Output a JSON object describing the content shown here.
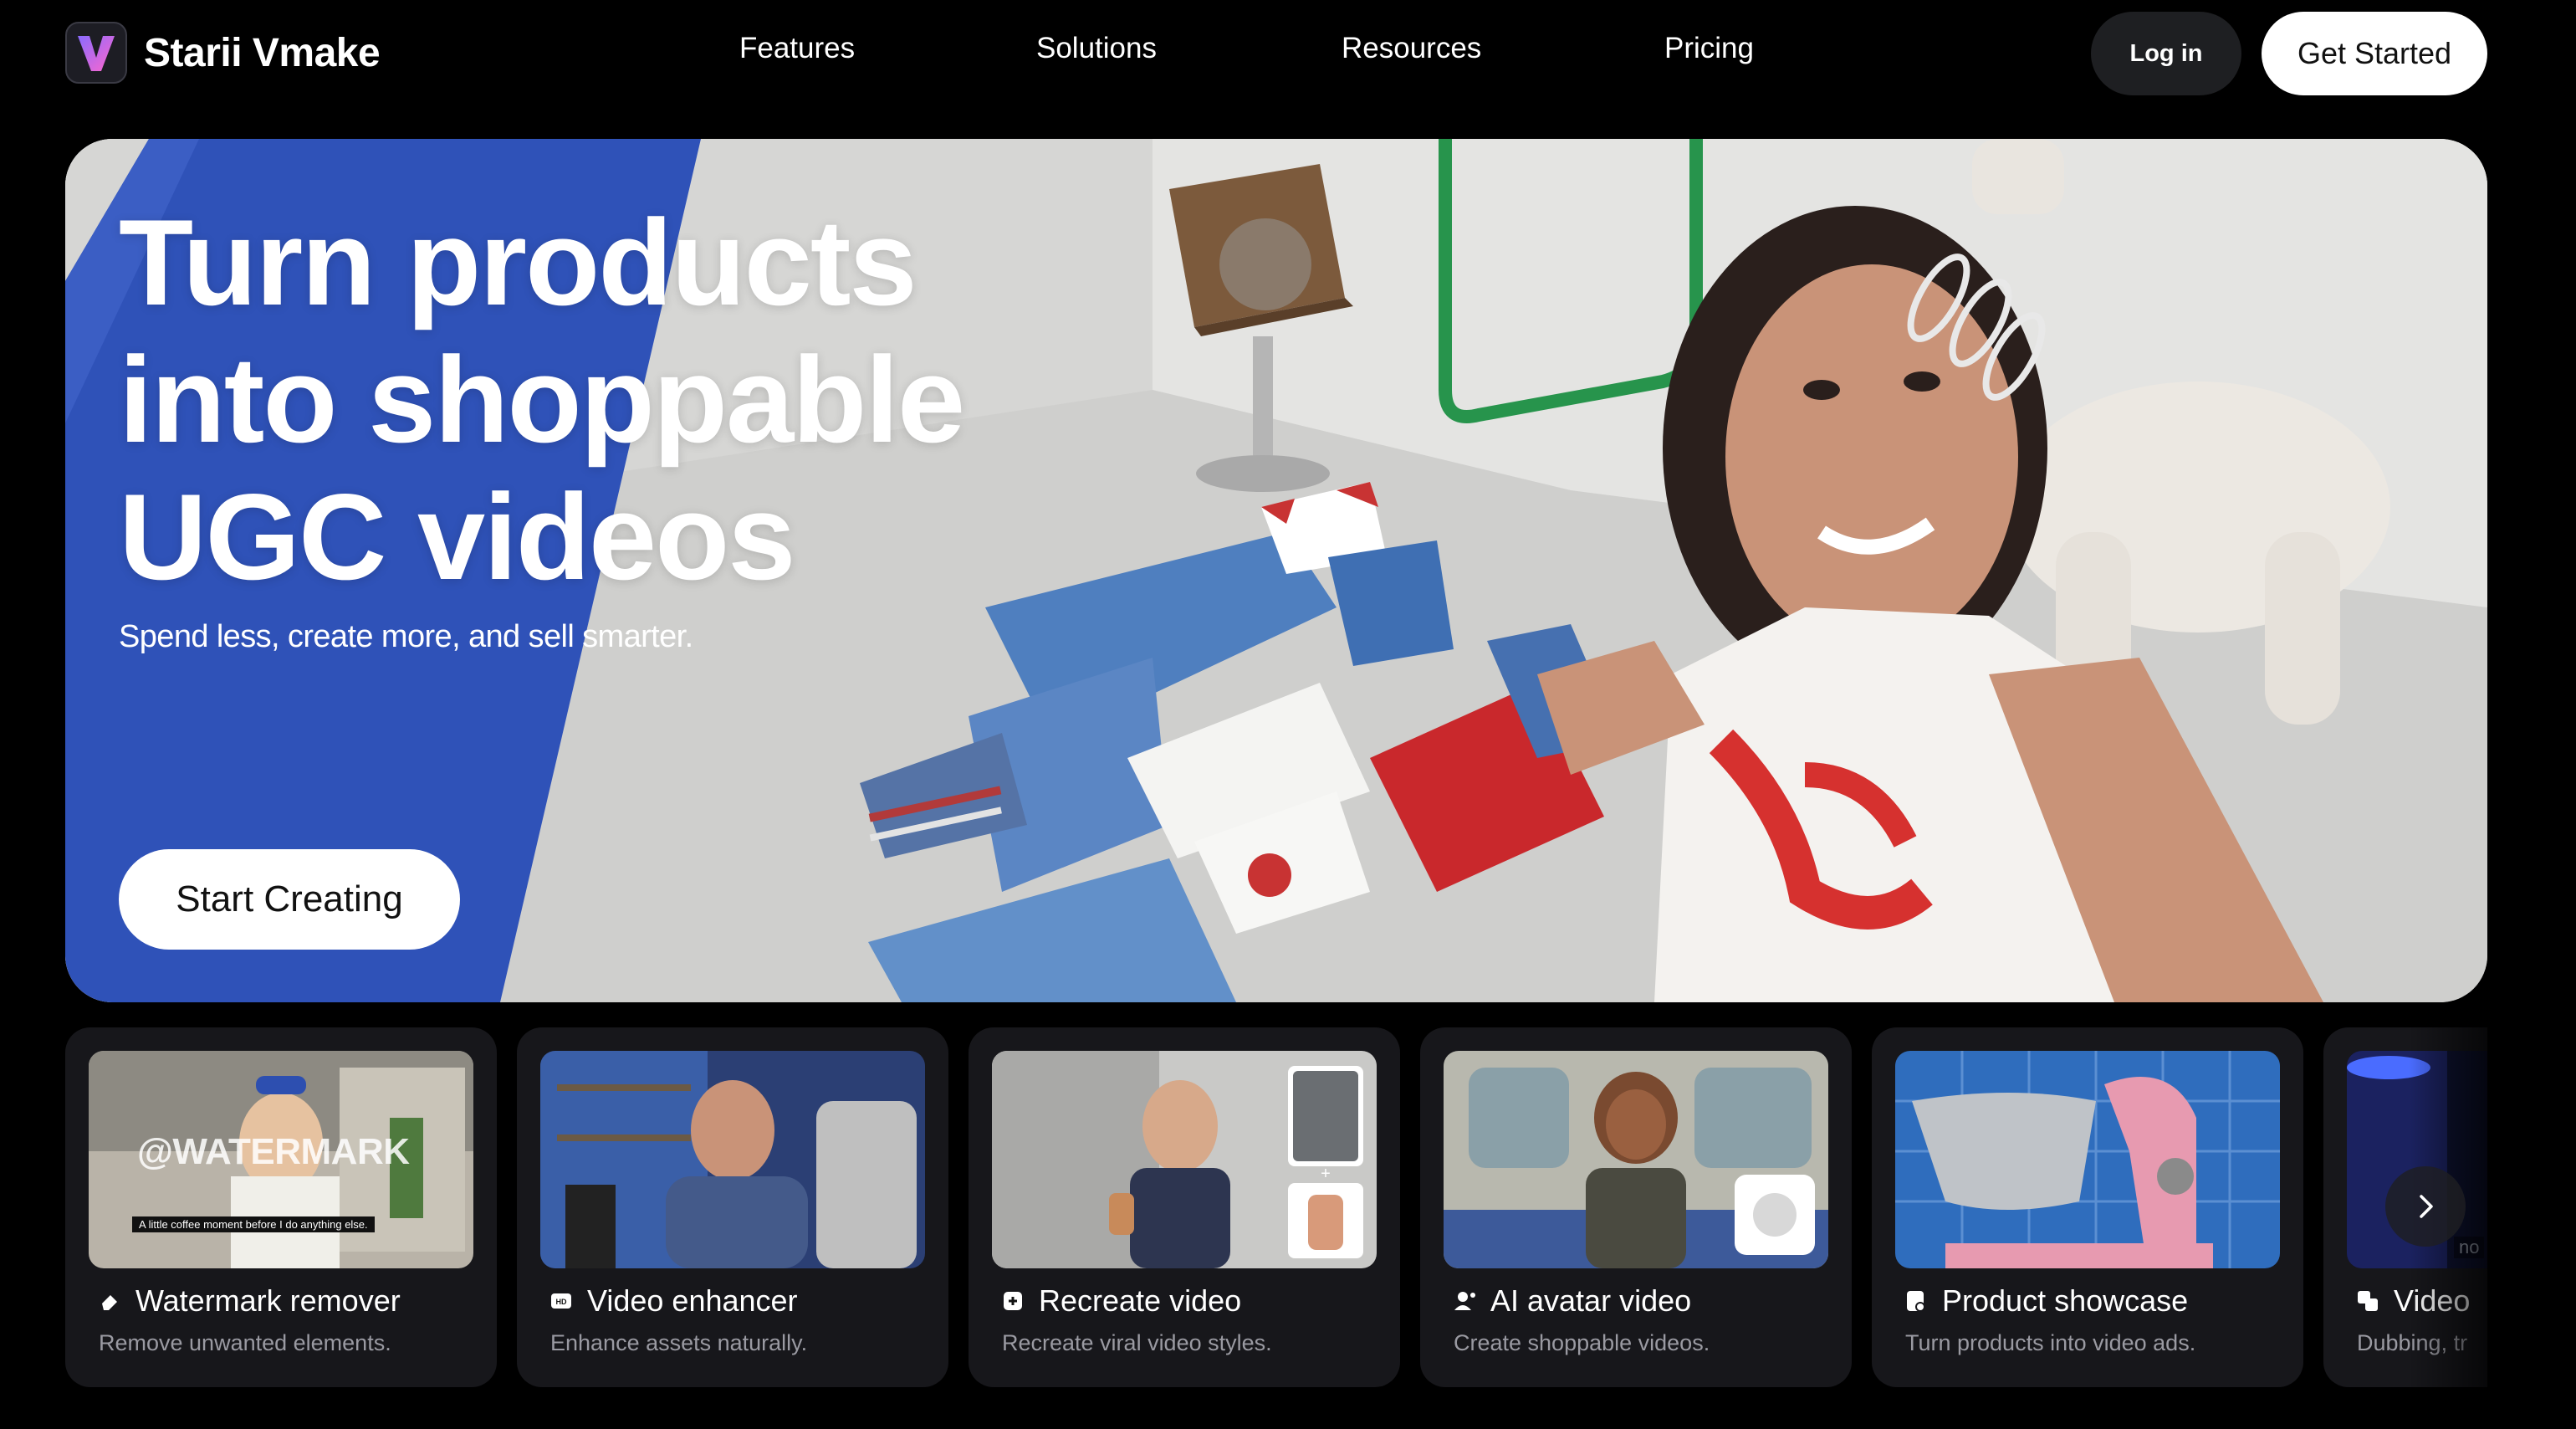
{
  "brand": {
    "name": "Starii Vmake",
    "logo_letter": "V"
  },
  "nav": {
    "links": [
      "Features",
      "Solutions",
      "Resources",
      "Pricing"
    ],
    "login": "Log in",
    "get_started": "Get Started"
  },
  "hero": {
    "title_lines": [
      "Turn products",
      "into shoppable",
      "UGC videos"
    ],
    "subtitle": "Spend less, create more, and sell smarter.",
    "cta": "Start Creating"
  },
  "cards": [
    {
      "title": "Watermark remover",
      "desc": "Remove unwanted elements.",
      "icon": "eraser-icon",
      "overlay_text": "@WATERMARK",
      "caption": "A little coffee moment before I do anything else."
    },
    {
      "title": "Video enhancer",
      "desc": "Enhance assets naturally.",
      "icon": "hd-icon"
    },
    {
      "title": "Recreate video",
      "desc": "Recreate viral video styles.",
      "icon": "recreate-icon"
    },
    {
      "title": "AI avatar video",
      "desc": "Create shoppable videos.",
      "icon": "avatar-icon"
    },
    {
      "title": "Product showcase",
      "desc": "Turn products into video ads.",
      "icon": "product-icon"
    },
    {
      "title": "Video",
      "desc": "Dubbing, tr",
      "icon": "translate-icon",
      "overlay_text": "no"
    }
  ],
  "colors": {
    "background": "#000000",
    "card": "#17171b",
    "muted_text": "#9a9aa2",
    "logo_gradient_start": "#6f5cff",
    "logo_gradient_end": "#ff5fd0",
    "hero_blue": "#2f52b8"
  }
}
